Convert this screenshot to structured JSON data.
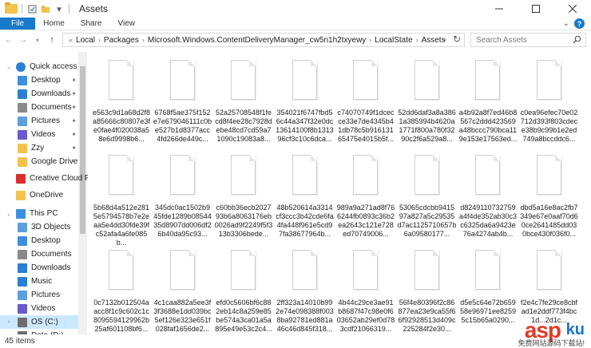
{
  "window": {
    "title": "Assets",
    "minimize_icon": "minimize-icon",
    "maximize_icon": "maximize-icon",
    "close_icon": "close-icon"
  },
  "ribbon": {
    "tabs": [
      "File",
      "Home",
      "Share",
      "View"
    ]
  },
  "address": {
    "crumbs": [
      "Local",
      "Packages",
      "Microsoft.Windows.ContentDeliveryManager_cw5n1h2txyewy",
      "LocalState",
      "Assets"
    ]
  },
  "search": {
    "placeholder": "Search Assets"
  },
  "sidebar": {
    "items": [
      {
        "label": "Quick access",
        "icon": "star-icon",
        "pinned": false
      },
      {
        "label": "Desktop",
        "icon": "desktop-icon",
        "pinned": true
      },
      {
        "label": "Downloads",
        "icon": "download-icon",
        "pinned": true
      },
      {
        "label": "Documents",
        "icon": "documents-icon",
        "pinned": true
      },
      {
        "label": "Pictures",
        "icon": "pictures-icon",
        "pinned": true
      },
      {
        "label": "Videos",
        "icon": "videos-icon",
        "pinned": true
      },
      {
        "label": "Zzy",
        "icon": "folder-icon",
        "pinned": true
      },
      {
        "label": "Google Drive",
        "icon": "folder-icon",
        "pinned": true
      },
      {
        "label": "Creative Cloud Files",
        "icon": "creative-cloud-icon",
        "pinned": false
      },
      {
        "label": "OneDrive",
        "icon": "onedrive-icon",
        "pinned": false
      },
      {
        "label": "This PC",
        "icon": "computer-icon",
        "pinned": false
      },
      {
        "label": "3D Objects",
        "icon": "3d-objects-icon",
        "pinned": false
      },
      {
        "label": "Desktop",
        "icon": "desktop-icon",
        "pinned": false
      },
      {
        "label": "Documents",
        "icon": "documents-icon",
        "pinned": false
      },
      {
        "label": "Downloads",
        "icon": "download-icon",
        "pinned": false
      },
      {
        "label": "Music",
        "icon": "music-icon",
        "pinned": false
      },
      {
        "label": "Pictures",
        "icon": "pictures-icon",
        "pinned": false
      },
      {
        "label": "Videos",
        "icon": "videos-icon",
        "pinned": false
      },
      {
        "label": "OS (C:)",
        "icon": "drive-icon",
        "pinned": false
      },
      {
        "label": "Data (D:)",
        "icon": "drive-icon",
        "pinned": false
      }
    ]
  },
  "files": [
    "e563c9d1a68d2f8a85666c80807e3fe0fae4f020038a58e6d9998b6...",
    "6768f5ae375f152e7e679046111c0be527b1d8377acc4fd266de449c...",
    "52a25708548f1fecd8f4ee28c7928debe48cd7cd59a71090c19083a8...",
    "354021f6747fbd56c44a347f32e0dc13614100f8b131396cf3c10c6dca...",
    "c74070749f1dcecce33e7de4345b41db78c5b91613165475e4015b5f...",
    "52dd6daf3a8a3861a385994b4620a1771f800a780f3290c2f6a529a8...",
    "a4b92a8f7ed46b8567c2ddd423569a48bccc790bca119e153e17563ed...",
    "c0ea96efec70e02712d393f803cdece38b9c99b1e2ed749a8bccddc6...",
    "5b68d4a512e2815e5794578b7e2eaa5e4dd30fde39fc52afa4a6fe085b...",
    "345dc0ac1502b945fde1289b0854435d8907dd006df26b40da95c93...",
    "c60bb36ecb202793b6a8063176eb0026ad9f2249f5f313b3306bede...",
    "48b520614a3314cf3ccc3b42cde6fa4fa448f961e5cd97fa38677964b...",
    "989a9a271ad8f766244fb0893c36b2ea2643c121e728ed70749006...",
    "53065cdcbb941597a827a5c29535d7ac1125710657b6a09580177...",
    "d8249110732759a4f4de352ab30c3c6325da6a9423e76a4274ab4b...",
    "dbd5a16e8ac2fb7349e67e0aaf70d60ce2641485dd030bce430f036f0...",
    "0c7132b012504aacc8f1c9c602c1c8095594129962b25af601108bf6...",
    "4c1caa882a5ee3f3f3688e1dd039bc5ef126e323e651f028faf1656de2...",
    "efd0c5606bf6c882eb14c8a259e85be574a3ca01a5a895e49e53c2c4...",
    "2ff323a14010b992e74e098388f0038ba92781ed881a46c46d845f318...",
    "4b44c29ce3ae91b8687f47c98e0f603652ab29ef0d783cdf21066319...",
    "56f4e80396f2c86877ea23e9ca55f66f92928513d409c225284f2e30...",
    "d5e5c64e72b65958e96971ee82595c15b65a0290...",
    "f2e4c7fe29ce8cbfad1e2ddf773f4bc1d...2d1c..."
  ],
  "status": {
    "count": "45 items"
  },
  "watermark": {
    "main": "asp",
    "ku": "ku",
    "sub": "免费网站源码下载站!"
  }
}
